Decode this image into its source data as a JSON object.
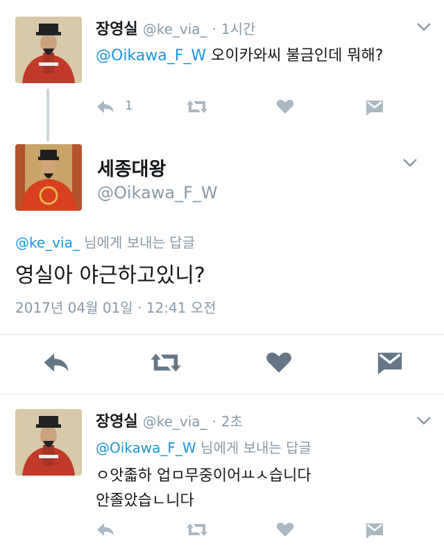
{
  "tweet1": {
    "name": "장영실",
    "handle": "@ke_via_",
    "dot": "·",
    "time": "1시간",
    "mention": "@Oikawa_F_W",
    "text": " 오이카와씨 불금인데 뭐해?",
    "reply_count": "1"
  },
  "main_tweet": {
    "name": "세종대왕",
    "handle": "@Oikawa_F_W",
    "reply_to_handle": "@ke_via_",
    "reply_to_suffix": " 님에게 보내는 답글",
    "text": "영실아 야근하고있니?",
    "date": "2017년 04월 01일 · 12:41 오전"
  },
  "tweet3": {
    "name": "장영실",
    "handle": "@ke_via_",
    "dot": "·",
    "time": "2초",
    "reply_to_handle": "@Oikawa_F_W",
    "reply_to_suffix": " 님에게 보내는 답글",
    "line1": "ㅇ앗졻하 업ㅁ무중이어ㅛㅅ습니다",
    "line2": "안졸았습ㄴ니다"
  },
  "icons": {
    "reply": "reply-icon",
    "retweet": "retweet-icon",
    "like": "heart-icon",
    "dm": "envelope-icon",
    "menu": "chevron-down-icon"
  },
  "colors": {
    "link": "#1b95e0",
    "muted": "#8899a6",
    "action_dark": "#657786",
    "divider": "#e1e8ed"
  }
}
